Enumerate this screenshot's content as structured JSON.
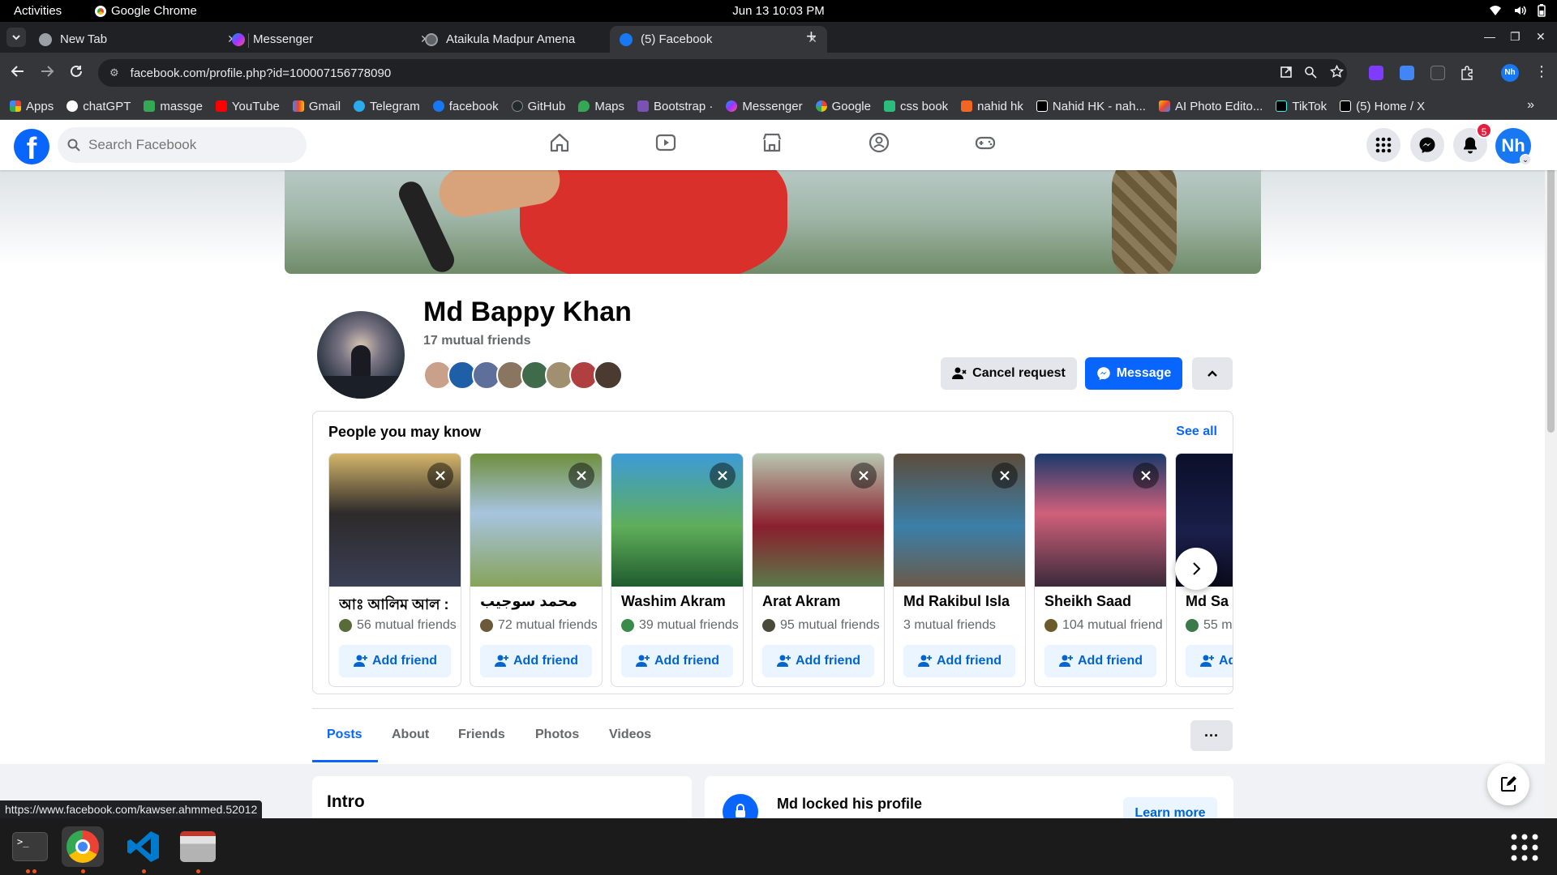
{
  "system": {
    "activities": "Activities",
    "app_name": "Google Chrome",
    "clock": "Jun 13  10:03 PM"
  },
  "tabs": [
    {
      "title": "New Tab",
      "favicon_color": "#9aa0a6",
      "active": false
    },
    {
      "title": "Messenger",
      "favicon_color": "#a334fa",
      "active": false
    },
    {
      "title": "Ataikula Madpur Amena",
      "favicon_color": "#5f6368",
      "active": false
    },
    {
      "title": "(5) Facebook",
      "favicon_color": "#1877f2",
      "active": true
    }
  ],
  "browser": {
    "url": "facebook.com/profile.php?id=100007156778090",
    "profile_initials": "Nh"
  },
  "bookmarks": [
    {
      "label": "Apps",
      "color": "#ea4335"
    },
    {
      "label": "chatGPT",
      "color": "#ffffff"
    },
    {
      "label": "massge",
      "color": "#34a853"
    },
    {
      "label": "YouTube",
      "color": "#ff0000"
    },
    {
      "label": "Gmail",
      "color": "#ea4335"
    },
    {
      "label": "Telegram",
      "color": "#2aabee"
    },
    {
      "label": "facebook",
      "color": "#1877f2"
    },
    {
      "label": "GitHub",
      "color": "#24292e"
    },
    {
      "label": "Maps",
      "color": "#34a853"
    },
    {
      "label": "Bootstrap ·",
      "color": "#7952b3"
    },
    {
      "label": "Messenger",
      "color": "#a334fa"
    },
    {
      "label": "Google",
      "color": "#4285f4"
    },
    {
      "label": "css book",
      "color": "#2bbd7e"
    },
    {
      "label": "nahid hk",
      "color": "#f26522"
    },
    {
      "label": "Nahid HK - nah...",
      "color": "#000000"
    },
    {
      "label": "AI Photo Edito...",
      "color": "#fbbc04"
    },
    {
      "label": "TikTok",
      "color": "#010101"
    },
    {
      "label": "(5) Home / X",
      "color": "#000000"
    }
  ],
  "facebook": {
    "search_placeholder": "Search Facebook",
    "notification_count": "5",
    "me_initials": "Nh"
  },
  "profile": {
    "name": "Md Bappy Khan",
    "mutual_friends": "17 mutual friends",
    "cancel_request": "Cancel request",
    "message": "Message",
    "mutual_avatar_colors": [
      "#c9a08a",
      "#1f5fa8",
      "#5d6f9a",
      "#8a7560",
      "#3f6b4a",
      "#a09070",
      "#b04040",
      "#4a3a30"
    ]
  },
  "pymk": {
    "title": "People you may know",
    "see_all": "See all",
    "add_friend": "Add friend",
    "people": [
      {
        "name": "আঃ আলিম আল :",
        "mutual": "56 mutual friends",
        "bg": "linear-gradient(180deg,#d4b56a 0%,#2d2a2a 45%,#3a3f55 100%)",
        "dot": "#5a6b3a"
      },
      {
        "name": "محمد سوجيب",
        "mutual": "72 mutual friends",
        "bg": "linear-gradient(180deg,#6f8f3e 0%,#a7c4df 45%,#87a35a 100%)",
        "dot": "#6b5a3a"
      },
      {
        "name": "Washim Akram",
        "mutual": "39 mutual friends",
        "bg": "linear-gradient(180deg,#3d9bd6 0%,#5fae5a 55%,#1f5c2e 100%)",
        "dot": "#3a8a4a"
      },
      {
        "name": "Arat Akram",
        "mutual": "95 mutual friends",
        "bg": "linear-gradient(180deg,#b8c6b0 0%,#8a1f2d 55%,#5a7a4a 100%)",
        "dot": "#4a4a3a"
      },
      {
        "name": "Md Rakibul Isla",
        "mutual": "3 mutual friends",
        "bg": "linear-gradient(180deg,#5c4c3c 0%,#3b7fa8 55%,#6a5a4a 100%)",
        "dot": ""
      },
      {
        "name": "Sheikh Saad",
        "mutual": "104 mutual friend",
        "bg": "linear-gradient(180deg,#1b3a6b 0%,#d0607a 45%,#3a2a3a 100%)",
        "dot": "#6b5a2a"
      },
      {
        "name": "Md Sa",
        "mutual": "55 m",
        "bg": "linear-gradient(180deg,#0a0f2a 0%,#1a1f4a 60%,#0a0a1a 100%)",
        "dot": "#3a7a4a"
      }
    ]
  },
  "profile_tabs": [
    "Posts",
    "About",
    "Friends",
    "Photos",
    "Videos"
  ],
  "intro_title": "Intro",
  "locked": {
    "title": "Md locked his profile",
    "learn_more": "Learn more"
  },
  "status_url": "https://www.facebook.com/kawser.ahmmed.52012"
}
